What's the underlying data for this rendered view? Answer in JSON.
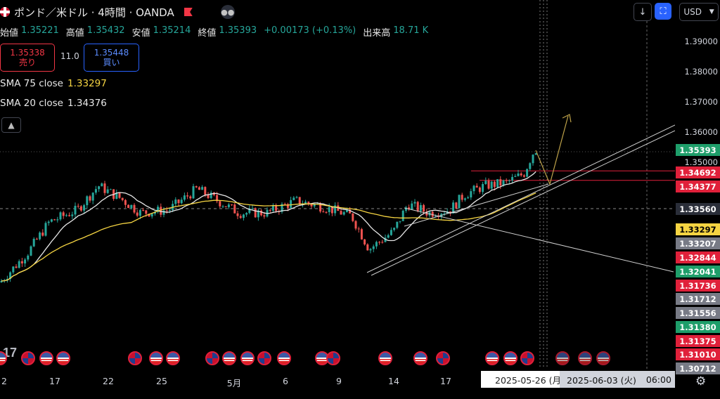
{
  "header": {
    "title": "ポンド／米ドル · 4時間 · OANDA",
    "ohlc": [
      {
        "label": "始値",
        "value": "1.35221"
      },
      {
        "label": "高値",
        "value": "1.35432"
      },
      {
        "label": "安値",
        "value": "1.35214"
      },
      {
        "label": "終値",
        "value": "1.35393"
      }
    ],
    "change": "+0.00173 (+0.13%)",
    "volume_label": "出来高",
    "volume": "18.71 K",
    "sell_price": "1.35338",
    "sell_label": "売り",
    "spread": "11.0",
    "buy_price": "1.35448",
    "buy_label": "買い"
  },
  "indicators": [
    {
      "name": "SMA 75 close",
      "value": "1.33297",
      "color": "#f5d442"
    },
    {
      "name": "SMA 20 close",
      "value": "1.34376",
      "color": "#e8e8e8"
    }
  ],
  "toolbar": {
    "collapse_icon": "chevron-up-icon",
    "download_icon": "arrow-down-icon",
    "settings_icon": "crop-icon",
    "currency": "USD"
  },
  "price_axis": {
    "ticks": [
      "1.39000",
      "1.38000",
      "1.37000",
      "1.36000",
      "1.35000",
      "1.33560"
    ],
    "badges": [
      {
        "value": "1.35393",
        "bg": "#1e9e6a",
        "fg": "#ffffff"
      },
      {
        "value": "1.34692",
        "bg": "#e0203a",
        "fg": "#ffffff"
      },
      {
        "value": "1.34377",
        "bg": "#e0203a",
        "fg": "#ffffff"
      },
      {
        "value": "1.33560",
        "bg": "#2a2e39",
        "fg": "#ffffff"
      },
      {
        "value": "1.33297",
        "bg": "#f5d442",
        "fg": "#000000"
      },
      {
        "value": "1.33207",
        "bg": "#787b86",
        "fg": "#ffffff"
      },
      {
        "value": "1.32844",
        "bg": "#e0203a",
        "fg": "#ffffff"
      },
      {
        "value": "1.32041",
        "bg": "#1e9e6a",
        "fg": "#ffffff"
      },
      {
        "value": "1.31736",
        "bg": "#e0203a",
        "fg": "#ffffff"
      },
      {
        "value": "1.31712",
        "bg": "#787b86",
        "fg": "#ffffff"
      },
      {
        "value": "1.31556",
        "bg": "#787b86",
        "fg": "#ffffff"
      },
      {
        "value": "1.31380",
        "bg": "#1e9e6a",
        "fg": "#ffffff"
      },
      {
        "value": "1.31375",
        "bg": "#e0203a",
        "fg": "#ffffff"
      },
      {
        "value": "1.31010",
        "bg": "#e0203a",
        "fg": "#ffffff"
      },
      {
        "value": "1.30712",
        "bg": "#787b86",
        "fg": "#ffffff"
      }
    ]
  },
  "time_axis": {
    "labels": [
      "2",
      "17",
      "22",
      "25",
      "5月",
      "6",
      "9",
      "14",
      "17"
    ],
    "crosshair_date": "2025-05-26 (月)",
    "cursor_date": "2025-06-03 (火)",
    "cursor_time": "06:00",
    "settings_icon": "gear-icon"
  },
  "colors": {
    "up": "#26a69a",
    "down": "#ef5350",
    "background": "#000000"
  },
  "watermark": "17"
}
